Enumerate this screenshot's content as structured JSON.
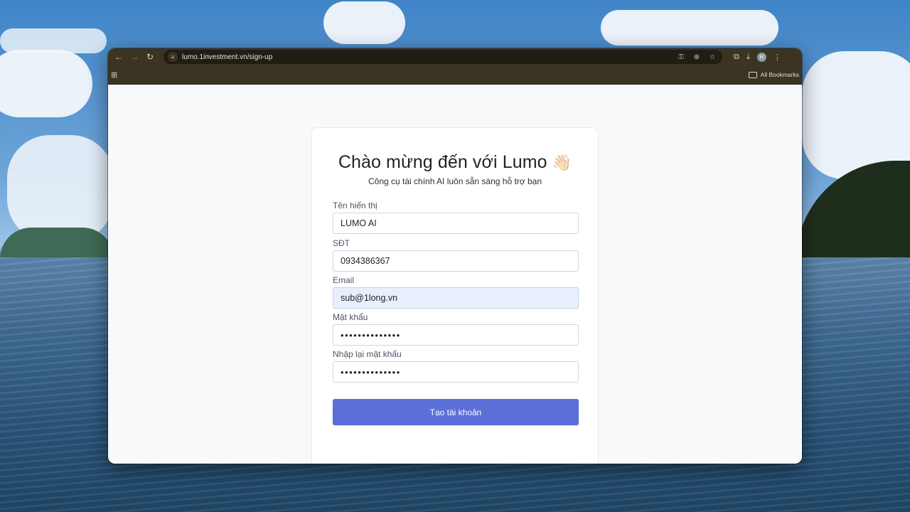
{
  "browser": {
    "url": "lumo.1investment.vn/sign-up",
    "all_bookmarks_label": "All Bookmarks",
    "profile_initial": "H",
    "theme_color": "#3b3423"
  },
  "form": {
    "title": "Chào mừng đến với Lumo",
    "title_emoji": "👋🏻",
    "subtitle": "Công cụ tài chính AI luôn sẵn sàng hỗ trợ bạn",
    "fields": [
      {
        "label": "Tên hiển thị",
        "value": "LUMO AI"
      },
      {
        "label": "SĐT",
        "value": "0934386367"
      },
      {
        "label": "Email",
        "value": "sub@1long.vn"
      },
      {
        "label": "Mật khẩu",
        "value": "••••••••••••••"
      },
      {
        "label": "Nhập lại mật khẩu",
        "value": "••••••••••••••"
      }
    ],
    "submit_label": "Tạo tài khoản",
    "accent_color": "#5a6fd8"
  }
}
